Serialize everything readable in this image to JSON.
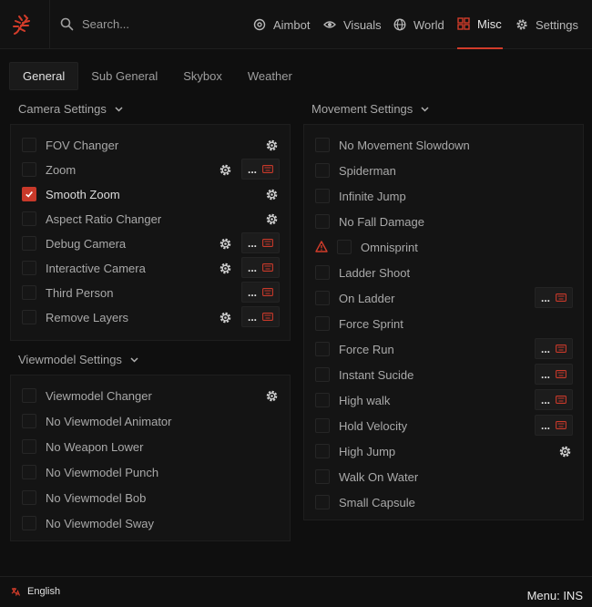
{
  "colors": {
    "accent": "#c8392a",
    "background": "#0f0f0f",
    "panel": "#141414"
  },
  "search": {
    "placeholder": "Search..."
  },
  "nav": {
    "tabs": [
      {
        "label": "Aimbot",
        "icon": "crosshair-icon",
        "active": false
      },
      {
        "label": "Visuals",
        "icon": "eye-icon",
        "active": false
      },
      {
        "label": "World",
        "icon": "globe-icon",
        "active": false
      },
      {
        "label": "Misc",
        "icon": "grid-icon",
        "active": true
      },
      {
        "label": "Settings",
        "icon": "gear-icon",
        "active": false
      }
    ]
  },
  "subtabs": [
    {
      "label": "General",
      "active": true
    },
    {
      "label": "Sub General",
      "active": false
    },
    {
      "label": "Skybox",
      "active": false
    },
    {
      "label": "Weather",
      "active": false
    }
  ],
  "camera": {
    "title": "Camera Settings",
    "items": [
      {
        "label": "FOV Changer",
        "checked": false,
        "gear": true,
        "keybind": false
      },
      {
        "label": "Zoom",
        "checked": false,
        "gear": true,
        "keybind": true
      },
      {
        "label": "Smooth Zoom",
        "checked": true,
        "gear": true,
        "keybind": false
      },
      {
        "label": "Aspect Ratio Changer",
        "checked": false,
        "gear": true,
        "keybind": false
      },
      {
        "label": "Debug Camera",
        "checked": false,
        "gear": true,
        "keybind": true
      },
      {
        "label": "Interactive Camera",
        "checked": false,
        "gear": true,
        "keybind": true
      },
      {
        "label": "Third Person",
        "checked": false,
        "gear": false,
        "keybind": true
      },
      {
        "label": "Remove Layers",
        "checked": false,
        "gear": true,
        "keybind": true
      }
    ]
  },
  "viewmodel": {
    "title": "Viewmodel Settings",
    "items": [
      {
        "label": "Viewmodel Changer",
        "checked": false,
        "gear": true,
        "keybind": false
      },
      {
        "label": "No Viewmodel Animator",
        "checked": false,
        "gear": false,
        "keybind": false
      },
      {
        "label": "No Weapon Lower",
        "checked": false,
        "gear": false,
        "keybind": false
      },
      {
        "label": "No Viewmodel Punch",
        "checked": false,
        "gear": false,
        "keybind": false
      },
      {
        "label": "No Viewmodel Bob",
        "checked": false,
        "gear": false,
        "keybind": false
      },
      {
        "label": "No Viewmodel Sway",
        "checked": false,
        "gear": false,
        "keybind": false
      }
    ]
  },
  "movement": {
    "title": "Movement Settings",
    "items": [
      {
        "label": "No Movement Slowdown",
        "checked": false,
        "gear": false,
        "keybind": false,
        "warning": false
      },
      {
        "label": "Spiderman",
        "checked": false,
        "gear": false,
        "keybind": false,
        "warning": false
      },
      {
        "label": "Infinite Jump",
        "checked": false,
        "gear": false,
        "keybind": false,
        "warning": false
      },
      {
        "label": "No Fall Damage",
        "checked": false,
        "gear": false,
        "keybind": false,
        "warning": false
      },
      {
        "label": "Omnisprint",
        "checked": false,
        "gear": false,
        "keybind": false,
        "warning": true
      },
      {
        "label": "Ladder Shoot",
        "checked": false,
        "gear": false,
        "keybind": false,
        "warning": false
      },
      {
        "label": "On Ladder",
        "checked": false,
        "gear": false,
        "keybind": true,
        "warning": false
      },
      {
        "label": "Force Sprint",
        "checked": false,
        "gear": false,
        "keybind": false,
        "warning": false
      },
      {
        "label": "Force Run",
        "checked": false,
        "gear": false,
        "keybind": true,
        "warning": false
      },
      {
        "label": "Instant Sucide",
        "checked": false,
        "gear": false,
        "keybind": true,
        "warning": false
      },
      {
        "label": "High walk",
        "checked": false,
        "gear": false,
        "keybind": true,
        "warning": false
      },
      {
        "label": "Hold Velocity",
        "checked": false,
        "gear": false,
        "keybind": true,
        "warning": false
      },
      {
        "label": "High Jump",
        "checked": false,
        "gear": true,
        "keybind": false,
        "warning": false
      },
      {
        "label": "Walk On Water",
        "checked": false,
        "gear": false,
        "keybind": false,
        "warning": false
      },
      {
        "label": "Small Capsule",
        "checked": false,
        "gear": false,
        "keybind": false,
        "warning": false
      }
    ]
  },
  "keybind_label": "...",
  "footer": {
    "language": "English",
    "menu_key": "Menu: INS"
  }
}
